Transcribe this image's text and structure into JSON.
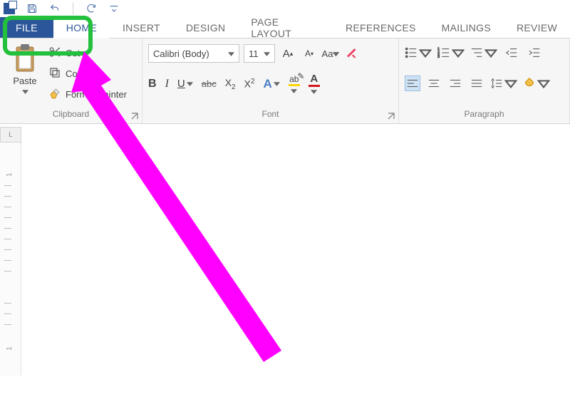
{
  "titlebar": {
    "qat": [
      "save-icon",
      "undo-icon",
      "redo-icon"
    ]
  },
  "tabs": {
    "file": "FILE",
    "home": "HOME",
    "insert": "INSERT",
    "design": "DESIGN",
    "page_layout": "PAGE LAYOUT",
    "references": "REFERENCES",
    "mailings": "MAILINGS",
    "review": "REVIEW"
  },
  "clipboard": {
    "paste": "Paste",
    "cut": "Cut",
    "copy": "Copy",
    "format_painter": "Format Painter",
    "group_label": "Clipboard"
  },
  "font": {
    "name": "Calibri (Body)",
    "size": "11",
    "group_label": "Font"
  },
  "paragraph": {
    "group_label": "Paragraph"
  },
  "ruler": {
    "corner": "L",
    "marks": [
      "1",
      "1"
    ]
  },
  "colors": {
    "accent": "#2b579a",
    "highlight": "#ffd500",
    "fontcolor": "#d4161b",
    "annotation_green": "#22c03c",
    "annotation_magenta": "#ff00ff"
  }
}
